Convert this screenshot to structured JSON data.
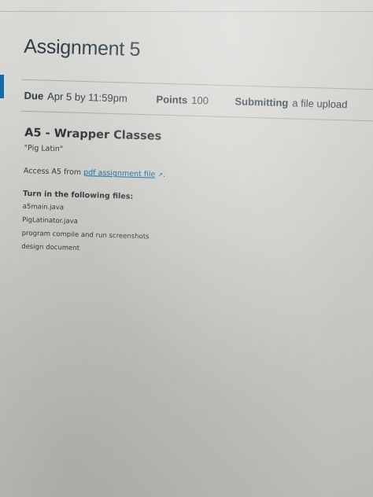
{
  "assignment": {
    "title": "Assignment 5"
  },
  "details": {
    "due_label": "Due",
    "due_value": "Apr 5 by 11:59pm",
    "points_label": "Points",
    "points_value": "100",
    "submitting_label": "Submitting",
    "submitting_value": "a file upload"
  },
  "description": {
    "heading": "A5 - Wrapper Classes",
    "subtitle": "\"Pig Latin\"",
    "access_prefix": "Access A5 from ",
    "access_link": "pdf assignment file",
    "access_suffix": ".",
    "turn_in_heading": "Turn in the following files:",
    "files": [
      "a5main.java",
      "PigLatinator.java",
      "program compile and run screenshots",
      "design document"
    ]
  },
  "colors": {
    "link": "#0a6aa6",
    "accent": "#0c6ba8",
    "text": "#2d3b45"
  }
}
